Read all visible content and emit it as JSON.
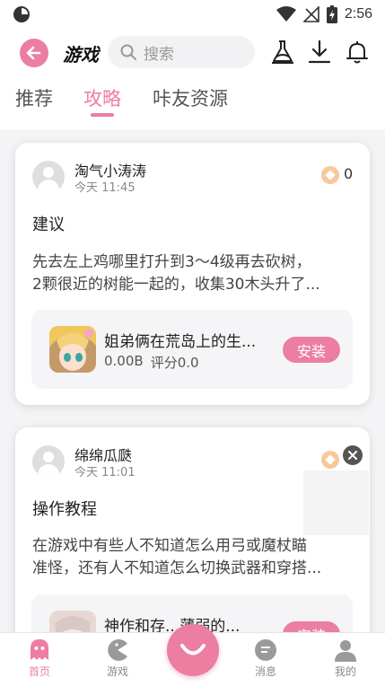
{
  "status_bar": {
    "time": "2:56"
  },
  "header": {
    "title": "游戏",
    "search_placeholder": "搜索"
  },
  "tabs": [
    {
      "label": "推荐",
      "active": false
    },
    {
      "label": "攻略",
      "active": true
    },
    {
      "label": "咔友资源",
      "active": false
    }
  ],
  "posts": [
    {
      "username": "淘气小涛涛",
      "time": "今天 11:45",
      "coins": "0",
      "title": "建议",
      "body_line1": "先去左上鸡哪里打升到3～4级再去砍树，",
      "body_line2": "2颗很近的树能一起的，收集30木头升了...",
      "game": {
        "name": "姐弟俩在荒岛上的生...",
        "size": "0.00B",
        "rating": "评分0.0",
        "button": "安装"
      }
    },
    {
      "username": "绵绵瓜瓞",
      "time": "今天 11:01",
      "title": "操作教程",
      "body_line1": "在游戏中有些人不知道怎么用弓或魔杖瞄",
      "body_line2": "准怪，还有人不知道怎么切换武器和穿搭...",
      "game": {
        "name": "神作和存...薄弱的...",
        "button": "安装"
      }
    }
  ],
  "bottom_nav": [
    {
      "label": "首页",
      "active": true
    },
    {
      "label": "游戏",
      "active": false
    },
    {
      "label": "消息",
      "active": false
    },
    {
      "label": "我的",
      "active": false
    }
  ],
  "colors": {
    "accent": "#ec7ea1",
    "coin": "#f7c89a"
  }
}
